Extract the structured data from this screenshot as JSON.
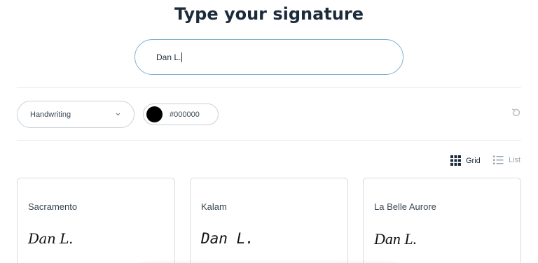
{
  "page": {
    "title": "Type your signature"
  },
  "signature_input": {
    "value": "Dan L."
  },
  "controls": {
    "font_select": {
      "selected": "Handwriting"
    },
    "color_picker": {
      "value": "#000000",
      "swatch_color": "#000000"
    },
    "reset_icon": "reset-icon"
  },
  "view": {
    "grid_label": "Grid",
    "list_label": "List",
    "active": "Grid"
  },
  "fonts": [
    {
      "name": "Sacramento",
      "preview": "Dan L."
    },
    {
      "name": "Kalam",
      "preview": "Dan L."
    },
    {
      "name": "La Belle Aurore",
      "preview": "Dan L."
    }
  ]
}
